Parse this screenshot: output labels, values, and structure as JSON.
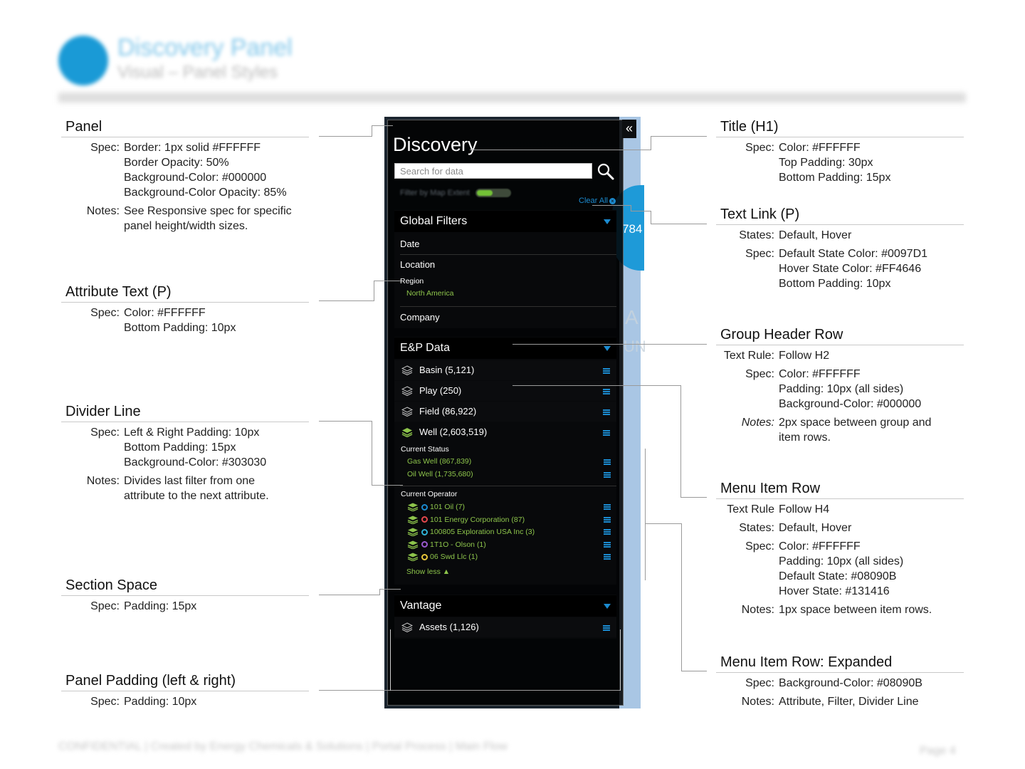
{
  "header": {
    "title": "Discovery Panel",
    "subtitle": "Visual – Panel Styles",
    "footer": "CONFIDENTIAL | Created by Energy Chemicals & Solutions | Portal Process | Main Flow",
    "page": "Page 4"
  },
  "annotations": {
    "panel": {
      "title": "Panel",
      "spec_label": "Spec:",
      "spec": [
        "Border: 1px solid #FFFFFF",
        "Border Opacity: 50%",
        "Background-Color: #000000",
        "Background-Color Opacity: 85%"
      ],
      "notes_label": "Notes:",
      "notes": [
        "See Responsive spec for specific",
        "panel height/width sizes."
      ]
    },
    "attribute_text": {
      "title": "Attribute Text (P)",
      "spec_label": "Spec:",
      "spec": [
        "Color: #FFFFFF",
        "Bottom Padding: 10px"
      ]
    },
    "divider_line": {
      "title": "Divider Line",
      "spec_label": "Spec:",
      "spec": [
        "Left & Right Padding: 10px",
        "Bottom Padding: 15px",
        "Background-Color: #303030"
      ],
      "notes_label": "Notes:",
      "notes": [
        "Divides last filter from one",
        "attribute to the next attribute."
      ]
    },
    "section_space": {
      "title": "Section Space",
      "spec_label": "Spec:",
      "spec": [
        "Padding: 15px"
      ]
    },
    "panel_padding": {
      "title": "Panel Padding (left & right)",
      "spec_label": "Spec:",
      "spec": [
        "Padding: 10px"
      ]
    },
    "title_h1": {
      "title": "Title (H1)",
      "spec_label": "Spec:",
      "spec": [
        "Color: #FFFFFF",
        "Top Padding: 30px",
        "Bottom Padding: 15px"
      ]
    },
    "text_link": {
      "title": "Text Link (P)",
      "states_label": "States:",
      "states": [
        "Default, Hover"
      ],
      "spec_label": "Spec:",
      "spec": [
        "Default State Color: #0097D1",
        "Hover State Color: #FF4646",
        "Bottom Padding: 10px"
      ]
    },
    "group_header": {
      "title": "Group Header Row",
      "rule_label": "Text Rule:",
      "rule": [
        "Follow H2"
      ],
      "spec_label": "Spec:",
      "spec": [
        "Color: #FFFFFF",
        "Padding: 10px (all sides)",
        "Background-Color: #000000"
      ],
      "notes_label": "Notes:",
      "notes": [
        "2px space between group and",
        "item rows."
      ]
    },
    "menu_item": {
      "title": "Menu Item Row",
      "rule_label": "Text Rule",
      "rule": [
        "Follow H4"
      ],
      "states_label": "States:",
      "states": [
        "Default, Hover"
      ],
      "spec_label": "Spec:",
      "spec": [
        "Color: #FFFFFF",
        "Padding: 10px (all sides)",
        "Default State: #08090B",
        "Hover State: #131416"
      ],
      "notes_label": "Notes:",
      "notes": [
        "1px space between item rows."
      ]
    },
    "menu_expanded": {
      "title": "Menu Item Row: Expanded",
      "spec_label": "Spec:",
      "spec": [
        "Background-Color: #08090B"
      ],
      "notes_label": "Notes:",
      "notes": [
        "Attribute, Filter, Divider Line"
      ]
    }
  },
  "panel": {
    "collapse_glyph": "«",
    "title": "Discovery",
    "search_placeholder": "Search for data",
    "toggle_label": "Filter by Map Extent",
    "clear_all": "Clear All",
    "clear_x": "×",
    "map_text": [
      "784",
      "A",
      "UN"
    ],
    "global_filters": {
      "header": "Global Filters",
      "items": [
        "Date",
        "Location",
        "Company"
      ],
      "region_label": "Region",
      "region_value": "North America"
    },
    "ep_data": {
      "header": "E&P Data",
      "items": [
        {
          "label": "Basin (5,121)"
        },
        {
          "label": "Play  (250)"
        },
        {
          "label": "Field  (86,922)"
        },
        {
          "label": "Well  (2,603,519)"
        }
      ],
      "current_status_label": "Current Status",
      "status_items": [
        "Gas Well (867,839)",
        "Oil Well (1,735,680)"
      ],
      "current_operator_label": "Current Operator",
      "operators": [
        {
          "label": "101 Oil (7)",
          "ring_color": "#1b8bd0"
        },
        {
          "label": "101 Energy Corporation (87)",
          "ring_color": "#e5484d"
        },
        {
          "label": "100805 Exploration USA Inc (3)",
          "ring_color": "#30b3d8"
        },
        {
          "label": "1T1O - Olson (1)",
          "ring_color": "#9b59d0"
        },
        {
          "label": "06 Swd Llc (1)",
          "ring_color": "#e8c63a"
        }
      ],
      "show_less": "Show less ▲"
    },
    "vantage": {
      "header": "Vantage",
      "items": [
        {
          "label": "Assets (1,126)"
        }
      ]
    }
  },
  "colors": {
    "accent_blue": "#1b8bd0",
    "green": "#8dc44b",
    "panel_bg": "#000000",
    "divider": "#303030",
    "row_default": "#08090B"
  }
}
